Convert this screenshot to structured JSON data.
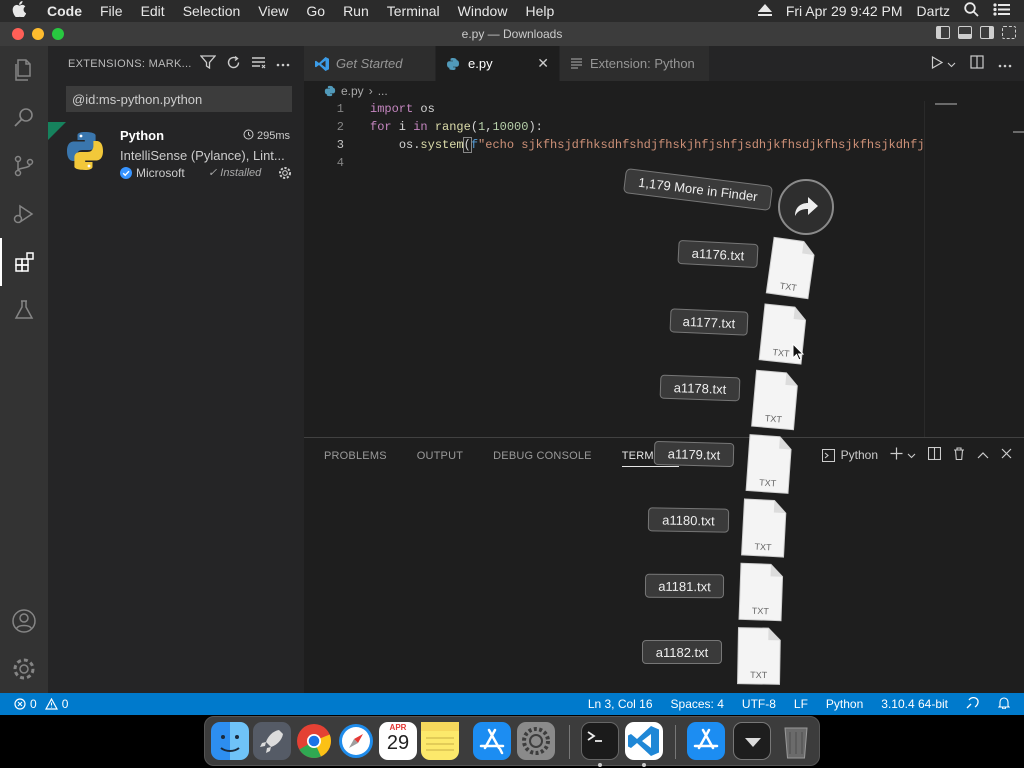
{
  "menubar": {
    "app": "Code",
    "items": [
      "File",
      "Edit",
      "Selection",
      "View",
      "Go",
      "Run",
      "Terminal",
      "Window",
      "Help"
    ],
    "datetime": "Fri Apr 29  9:42 PM",
    "user": "Dartz"
  },
  "window": {
    "title": "e.py — Downloads"
  },
  "sidebar": {
    "header": "EXTENSIONS: MARK...",
    "search_value": "@id:ms-python.python",
    "extension": {
      "name": "Python",
      "time": "295ms",
      "description": "IntelliSense (Pylance), Lint...",
      "publisher": "Microsoft",
      "status": "Installed"
    }
  },
  "tabs": [
    {
      "label": "Get Started"
    },
    {
      "label": "e.py"
    },
    {
      "label": "Extension: Python"
    }
  ],
  "breadcrumb": {
    "file": "e.py",
    "rest": "..."
  },
  "editor": {
    "line_numbers": [
      "1",
      "2",
      "3",
      "4"
    ],
    "line1": {
      "kw": "import",
      "rest": " os"
    },
    "line2": {
      "kw1": "for",
      "var": " i ",
      "kw2": "in",
      "sp": " ",
      "fn": "range",
      "open": "(",
      "n1": "1",
      "comma": ",",
      "n2": "10000",
      "close": "):"
    },
    "line3": {
      "indent": "    ",
      "obj": "os",
      "dot": ".",
      "fn": "system",
      "paren": "(",
      "fprefix": "f",
      "str": "\"echo sjkfhsjdfhksdhfshdjfhskjhfjshfjsdhjkfhsdjkfhsjkfhsjkdhfj"
    }
  },
  "panel": {
    "tabs": [
      "PROBLEMS",
      "OUTPUT",
      "DEBUG CONSOLE",
      "TERMINAL"
    ],
    "terminal_name": "Python"
  },
  "statusbar": {
    "errors": "0",
    "warnings": "0",
    "position": "Ln 3, Col 16",
    "spaces": "Spaces: 4",
    "encoding": "UTF-8",
    "eol": "LF",
    "language": "Python",
    "interpreter": "3.10.4 64-bit"
  },
  "drag_stack": {
    "more_label": "1,179 More in Finder",
    "files": [
      "a1176.txt",
      "a1177.txt",
      "a1178.txt",
      "a1179.txt",
      "a1180.txt",
      "a1181.txt",
      "a1182.txt"
    ],
    "file_type": "TXT"
  },
  "dock": {
    "calendar_month": "APR",
    "calendar_day": "29"
  },
  "colors": {
    "accent": "#007acc",
    "activity_bar": "#333333",
    "sidebar": "#252526",
    "editor": "#1e1e1e"
  }
}
